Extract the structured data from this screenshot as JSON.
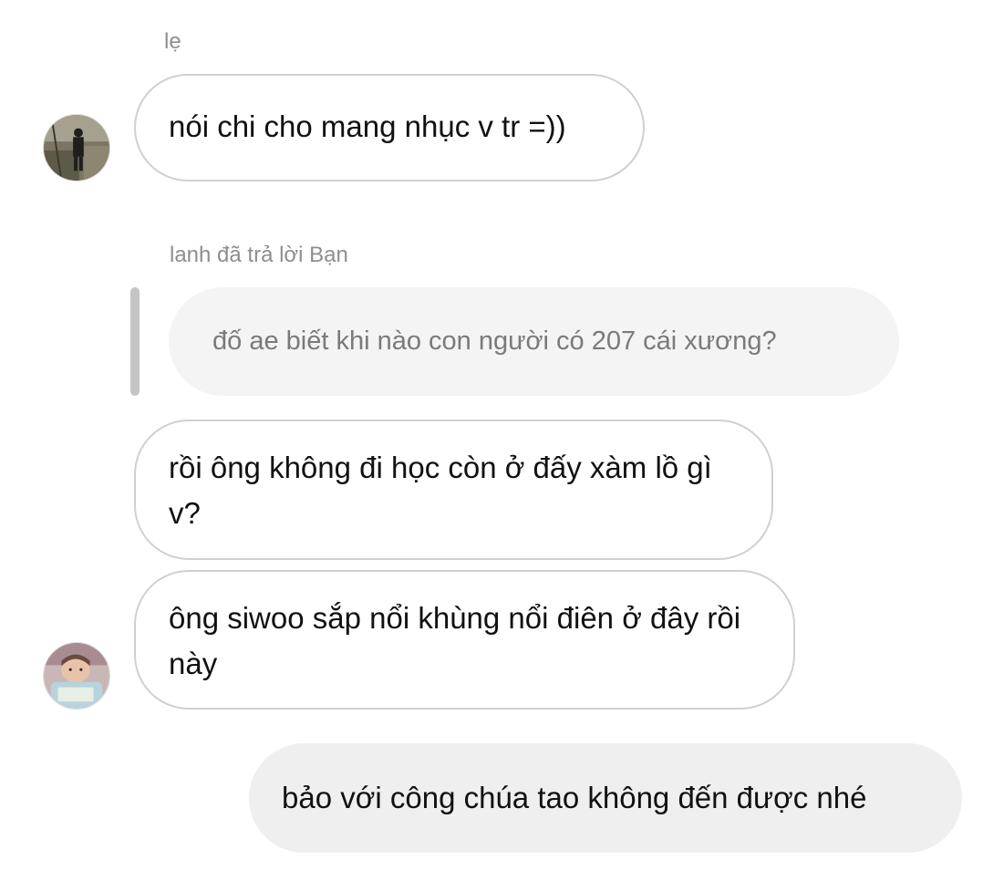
{
  "messages": [
    {
      "sender": "lẹ",
      "text": "nói chi cho mang nhục v tr =))",
      "avatar_icon": "person-photo-icon"
    },
    {
      "reply_header": "lanh đã trả lời Bạn",
      "quoted_text": "đố ae biết khi nào con người có 207 cái xương?",
      "text": "rồi ông không đi học còn ở đấy xàm lồ gì v?"
    },
    {
      "text": "ông siwoo sắp nổi khùng nổi điên ở đây rồi này",
      "avatar_icon": "baby-photo-icon"
    },
    {
      "text": "bảo với công chúa tao không đến được nhé",
      "outgoing": true
    }
  ],
  "colors": {
    "incoming_border": "#d0d0d0",
    "outgoing_bg": "#efefef",
    "quote_bg": "#f4f4f4",
    "quote_bar": "#c4c4c4",
    "meta_text": "#8e8e8e"
  }
}
